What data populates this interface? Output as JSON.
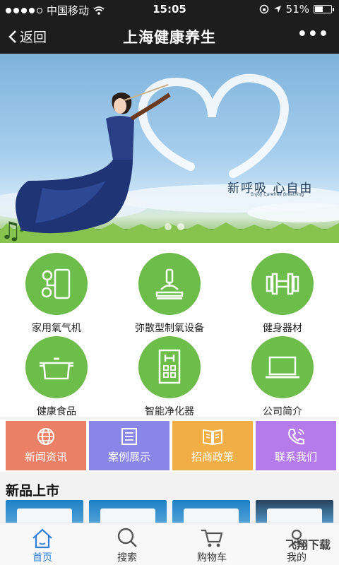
{
  "status": {
    "carrier": "中国移动",
    "time": "15:05",
    "battery": "51%"
  },
  "nav": {
    "back_label": "返回",
    "title": "上海健康养生",
    "more": "•••"
  },
  "banner": {
    "headline": "新呼吸 心自由",
    "subline": "Enjoy Carefree Breathing"
  },
  "categories": [
    {
      "label": "家用氧气机",
      "icon": "oxygen-machine-icon"
    },
    {
      "label": "弥散型制氧设备",
      "icon": "microscope-icon"
    },
    {
      "label": "健身器材",
      "icon": "dumbbell-icon"
    },
    {
      "label": "健康食品",
      "icon": "pot-icon"
    },
    {
      "label": "智能净化器",
      "icon": "purifier-icon"
    },
    {
      "label": "公司简介",
      "icon": "laptop-icon"
    }
  ],
  "tiles": [
    {
      "label": "新闻资讯",
      "color": "#ec8066",
      "icon": "globe-icon"
    },
    {
      "label": "案例展示",
      "color": "#8a86e8",
      "icon": "document-icon"
    },
    {
      "label": "招商政策",
      "color": "#f1ae47",
      "icon": "book-icon"
    },
    {
      "label": "联系我们",
      "color": "#b67bea",
      "icon": "phone-icon"
    }
  ],
  "section": {
    "title": "新品上市"
  },
  "tabbar": [
    {
      "label": "首页",
      "icon": "home-icon",
      "active": true
    },
    {
      "label": "搜索",
      "icon": "search-icon",
      "active": false
    },
    {
      "label": "购物车",
      "icon": "cart-icon",
      "active": false
    },
    {
      "label": "我的",
      "icon": "user-icon",
      "active": false
    }
  ],
  "watermark": "飞翔下载",
  "colors": {
    "bar": "#1d1d1d",
    "accent_green": "#6cbd4a",
    "tab_active": "#2f7fd8"
  }
}
